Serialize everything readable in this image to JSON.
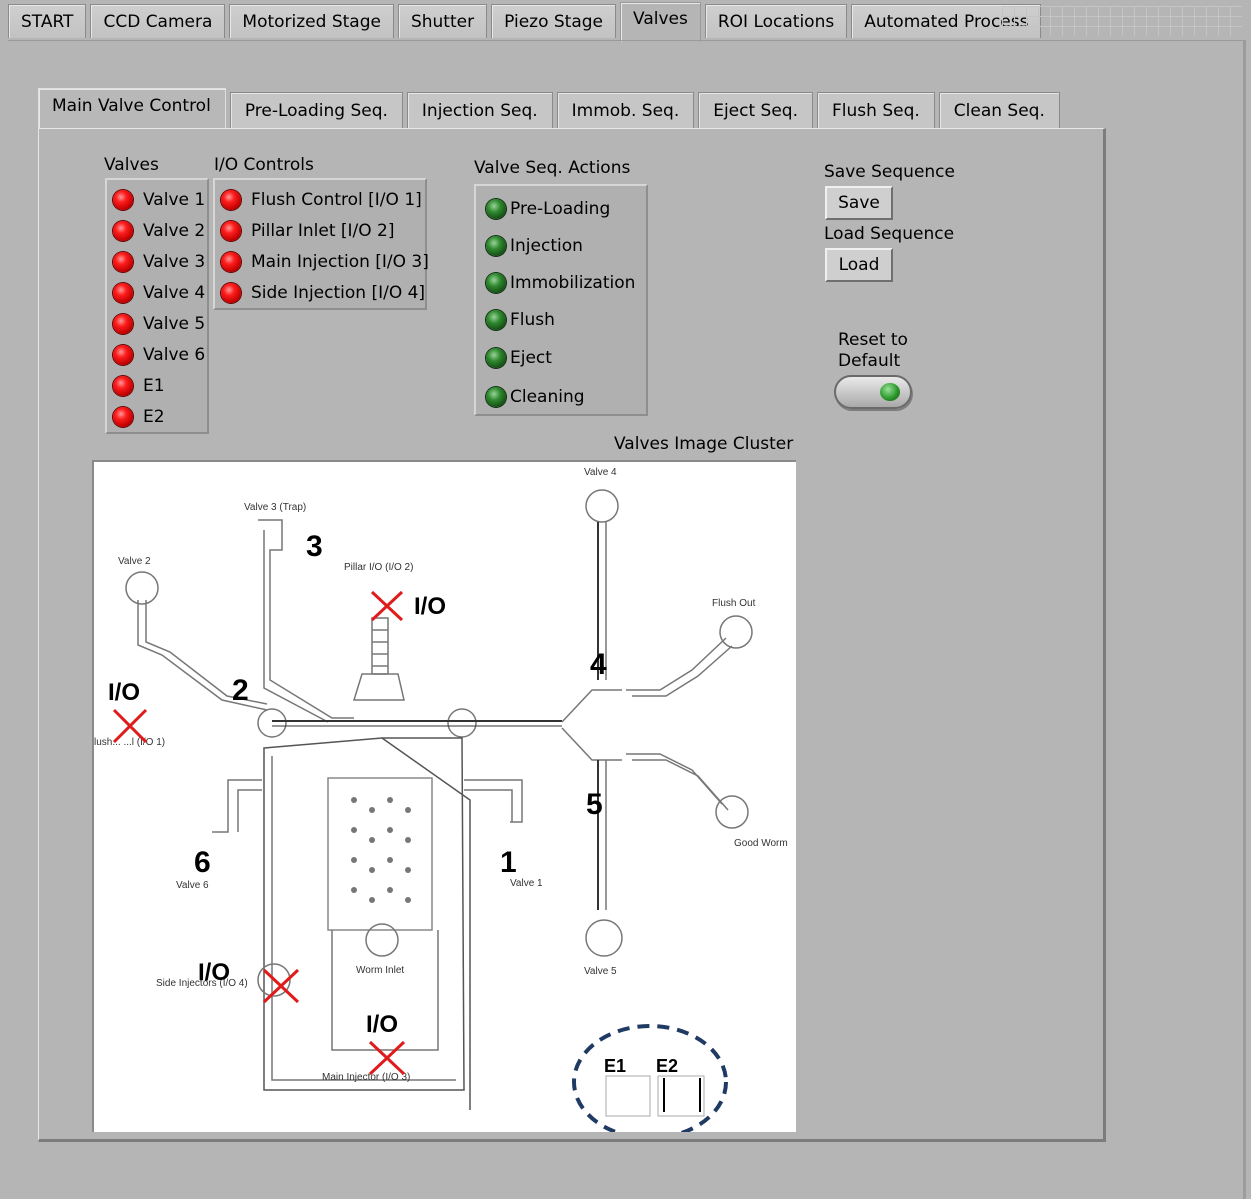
{
  "top_tabs": [
    "START",
    "CCD Camera",
    "Motorized Stage",
    "Shutter",
    "Piezo Stage",
    "Valves",
    "ROI Locations",
    "Automated Process"
  ],
  "active_top_tab": "Valves",
  "sub_tabs": [
    "Main Valve Control",
    "Pre-Loading Seq.",
    "Injection Seq.",
    "Immob. Seq.",
    "Eject Seq.",
    "Flush Seq.",
    "Clean Seq."
  ],
  "active_sub_tab": "Main Valve Control",
  "valves": {
    "title": "Valves",
    "items": [
      "Valve 1",
      "Valve 2",
      "Valve 3",
      "Valve 4",
      "Valve 5",
      "Valve 6",
      "E1",
      "E2"
    ]
  },
  "io_controls": {
    "title": "I/O Controls",
    "items": [
      "Flush Control [I/O 1]",
      "Pillar Inlet [I/O 2]",
      "Main Injection [I/O 3]",
      "Side Injection [I/O 4]"
    ]
  },
  "seq_actions": {
    "title": "Valve Seq. Actions",
    "items": [
      "Pre-Loading",
      "Injection",
      "Immobilization",
      "Flush",
      "Eject",
      "Cleaning"
    ]
  },
  "save_sequence": {
    "title": "Save Sequence",
    "button": "Save"
  },
  "load_sequence": {
    "title": "Load Sequence",
    "button": "Load"
  },
  "reset": {
    "line1": "Reset to",
    "line2": "Default"
  },
  "image_cluster": {
    "title": "Valves Image Cluster",
    "labels": {
      "valve4": "Valve 4",
      "valve3": "Valve 3 (Trap)",
      "valve2": "Valve 2",
      "pillar": "Pillar I/O (I/O 2)",
      "flush_out": "Flush Out",
      "good_worm": "Good Worm",
      "valve6": "Valve 6",
      "valve1": "Valve 1",
      "valve5": "Valve 5",
      "worm_inlet": "Worm Inlet",
      "side_injector": "Side Injectors (I/O 4)",
      "main_injector": "Main Injector (I/O 3)",
      "flush_control": "lush... ...l (I/O 1)"
    },
    "numbers": [
      "3",
      "2",
      "4",
      "5",
      "6",
      "1"
    ],
    "io_text": "I/O",
    "e_labels": [
      "E1",
      "E2"
    ]
  },
  "colors": {
    "led_off_red": "#e01010",
    "led_green": "#1f6b1f",
    "x_mark": "#e01b1b",
    "dashed_circle": "#1f3a63"
  }
}
